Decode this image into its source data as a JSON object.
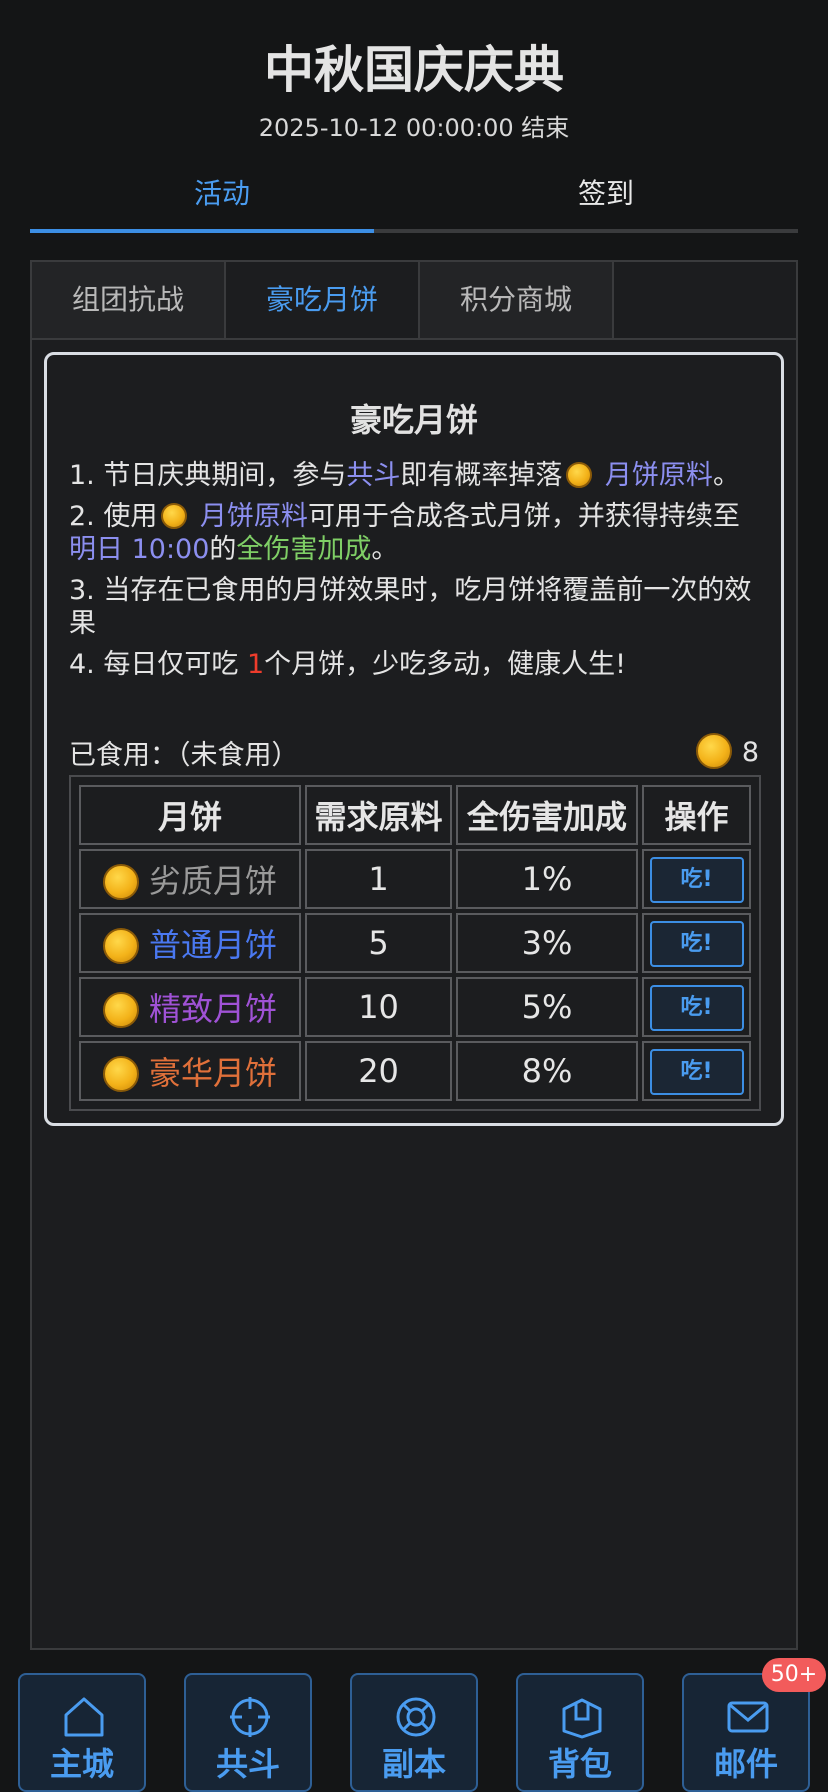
{
  "header": {
    "title": "中秋国庆庆典",
    "end_time": "2025-10-12 00:00:00 结束"
  },
  "top_tabs": [
    {
      "label": "活动",
      "active": true
    },
    {
      "label": "签到",
      "active": false
    }
  ],
  "sub_tabs": [
    {
      "label": "组团抗战"
    },
    {
      "label": "豪吃月饼",
      "active": true
    },
    {
      "label": "积分商城"
    }
  ],
  "card": {
    "title": "豪吃月饼",
    "rule1": {
      "a": "1. 节日庆典期间，参与",
      "b": "共斗",
      "c": "即有概率掉落",
      "d": " 月饼原料",
      "e": "。"
    },
    "rule2": {
      "a": "2. 使用",
      "b": " 月饼原料",
      "c": "可用于合成各式月饼，并获得持续至",
      "d": "明日 10:00",
      "e": "的",
      "f": "全伤害加成",
      "g": "。"
    },
    "rule3": "3. 当存在已食用的月饼效果时，吃月饼将覆盖前一次的效果",
    "rule4": {
      "a": "4. 每日仅可吃 ",
      "b": "1",
      "c": "个月饼，少吃多动，健康人生!"
    },
    "eaten_label": "已食用：（未食用）",
    "balance": "8",
    "table": {
      "headers": [
        "月饼",
        "需求原料",
        "全伤害加成",
        "操作"
      ],
      "rows": [
        {
          "name": "劣质月饼",
          "cost": "1",
          "bonus": "1%",
          "action": "吃!",
          "quality": "poor"
        },
        {
          "name": "普通月饼",
          "cost": "5",
          "bonus": "3%",
          "action": "吃!",
          "quality": "common"
        },
        {
          "name": "精致月饼",
          "cost": "10",
          "bonus": "5%",
          "action": "吃!",
          "quality": "fine"
        },
        {
          "name": "豪华月饼",
          "cost": "20",
          "bonus": "8%",
          "action": "吃!",
          "quality": "lux"
        }
      ]
    }
  },
  "bottom_nav": [
    {
      "label": "主城",
      "icon": "home-icon"
    },
    {
      "label": "共斗",
      "icon": "crosshair-icon"
    },
    {
      "label": "副本",
      "icon": "lifebuoy-icon"
    },
    {
      "label": "背包",
      "icon": "box-icon"
    },
    {
      "label": "邮件",
      "icon": "mail-icon"
    }
  ],
  "mail_badge": "50+",
  "colors": {
    "accent": "#4a9cf0",
    "badge": "#f25b5b",
    "card_border": "#d9dde3"
  }
}
